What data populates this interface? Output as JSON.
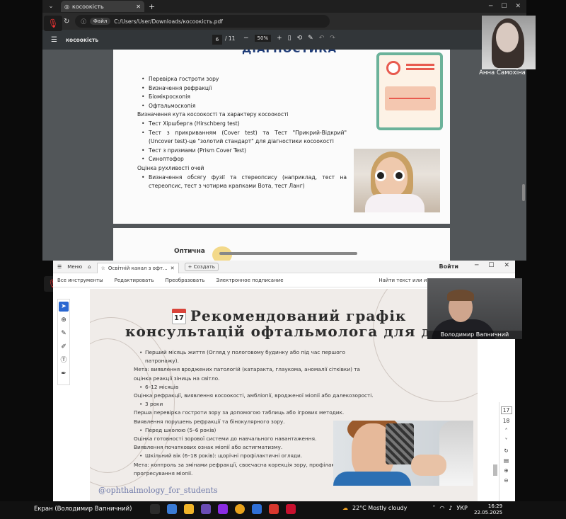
{
  "browser": {
    "tab_title": "косоокість",
    "file_chip": "Файл",
    "address": "C:/Users/User/Downloads/косоокість.pdf"
  },
  "pdf_toolbar": {
    "doc_name": "косоокість",
    "page_current": "6",
    "page_total": "/ 11",
    "zoom": "50%"
  },
  "pdf_page1": {
    "title": "ДІАГНОСТИКА",
    "lines": [
      {
        "kind": "b",
        "text": "Перевірка гостроти зору"
      },
      {
        "kind": "b",
        "text": "Визначення рефракції"
      },
      {
        "kind": "b",
        "text": "Біомікроскопія"
      },
      {
        "kind": "b",
        "text": "Офтальмоскопія"
      },
      {
        "kind": "h",
        "text": "Визначення кута косоокості та характеру косоокості"
      },
      {
        "kind": "b",
        "text": "Тест Хіршберга (Hirschberg test)"
      },
      {
        "kind": "b",
        "text": "Тест з прикриванням (Cover test) та Тест \"Прикрий-Відкрий\" (Uncover test)-це \"золотий стандарт\" для діагностики косоокості"
      },
      {
        "kind": "b",
        "text": "Тест з призмами (Prism Cover Test)"
      },
      {
        "kind": "b",
        "text": "Синоптофор"
      },
      {
        "kind": "h",
        "text": "Оцінка рухливості очей"
      },
      {
        "kind": "b",
        "text": "Визначення обсягу фузії та стереопсису (наприклад, тест на стереопсис, тест з чотирма крапками Вота, тест Ланг)"
      }
    ]
  },
  "pdf_page2": {
    "partial_text": "Оптична"
  },
  "acrobat": {
    "menu_label": "Меню",
    "tab_title": "Освітній канал з офт...",
    "create_label": "Создать",
    "login_label": "Войти",
    "menu_items": [
      "Все инструменты",
      "Редактировать",
      "Преобразовать",
      "Электронное подписание"
    ],
    "search_label": "Найти текст или ин"
  },
  "doc": {
    "title_line1": "Рекомендований графік",
    "title_line2": "консультацій офтальмолога для дітей",
    "calendar_day": "17",
    "body": [
      {
        "kind": "bl",
        "text": "Перший місяць життя (Огляд у пологовому будинку або під час першого патронажу)."
      },
      {
        "kind": "tx",
        "text": "Мета: виявлення вроджених патологій (катаракта, глаукома, аномалії сітківки) та оцінка реакції зіниць на світло."
      },
      {
        "kind": "bl",
        "text": "6–12 місяців"
      },
      {
        "kind": "tx",
        "text": "Оцінка рефракції, виявлення косоокості, амбліопії, вродженої міопії або далекозорості."
      },
      {
        "kind": "bl",
        "text": "3 роки"
      },
      {
        "kind": "tx",
        "text": "Перша перевірка гостроти зору за допомогою таблиць або ігрових методик."
      },
      {
        "kind": "tx",
        "text": "Виявлення порушень рефракції та бінокулярного зору."
      },
      {
        "kind": "bl",
        "text": "Перед школою (5–6 років)"
      },
      {
        "kind": "tx",
        "text": "Оцінка готовності зорової системи до навчального навантаження."
      },
      {
        "kind": "tx",
        "text": "Виявлення початкових ознак міопії або астигматизму."
      },
      {
        "kind": "bl",
        "text": "Шкільний вік (6–18 років): щорічні профілактичні огляди."
      },
      {
        "kind": "tx",
        "text": "Мета: контроль за змінами рефракції, своєчасна корекція зору, профілактика прогресування міопії."
      }
    ],
    "instagram": "@ophthalmology_for_students"
  },
  "rail": {
    "page_a": "17",
    "page_b": "18"
  },
  "participants": {
    "anna": "Анна Самохіна",
    "vova": "Володимир Вапничний"
  },
  "taskbar": {
    "screen_label": "Екран (Володимир Вапничний)",
    "weather": "22°C  Mostly cloudy",
    "lang": "УКР",
    "time": "16:29",
    "date": "22.05.2025"
  }
}
